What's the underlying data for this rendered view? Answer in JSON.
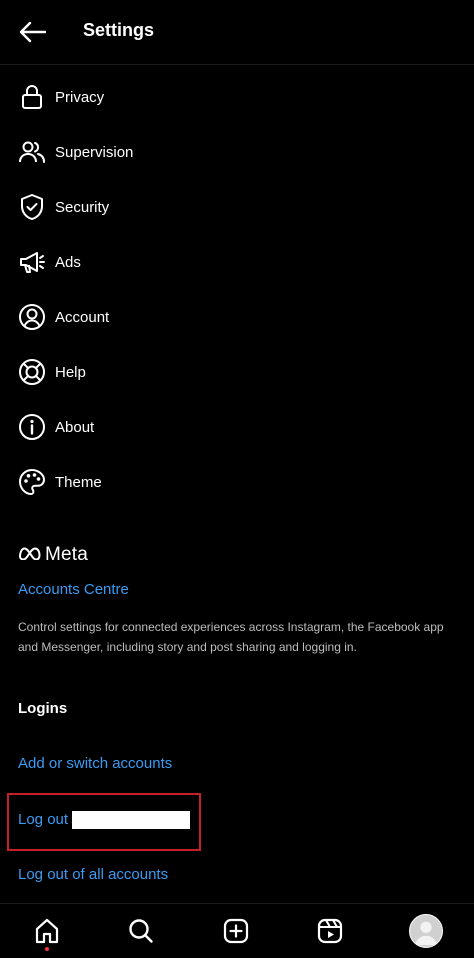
{
  "header": {
    "title": "Settings",
    "back_icon": "arrow-left-icon"
  },
  "menu": [
    {
      "label": "Privacy",
      "icon": "lock-icon"
    },
    {
      "label": "Supervision",
      "icon": "people-icon"
    },
    {
      "label": "Security",
      "icon": "shield-check-icon"
    },
    {
      "label": "Ads",
      "icon": "megaphone-icon"
    },
    {
      "label": "Account",
      "icon": "user-circle-icon"
    },
    {
      "label": "Help",
      "icon": "lifebuoy-icon"
    },
    {
      "label": "About",
      "icon": "info-icon"
    },
    {
      "label": "Theme",
      "icon": "palette-icon"
    }
  ],
  "meta": {
    "brand": "Meta",
    "accounts_centre": "Accounts Centre",
    "description": "Control settings for connected experiences across Instagram, the Facebook app and Messenger, including story and post sharing and logging in."
  },
  "logins": {
    "heading": "Logins",
    "add_switch": "Add or switch accounts",
    "log_out": "Log out",
    "log_out_all": "Log out of all accounts"
  },
  "colors": {
    "link": "#3b9bf2",
    "highlight_border": "#c4202a",
    "notification_dot": "#ff3040"
  },
  "bottom_nav": [
    "home-icon",
    "search-icon",
    "create-icon",
    "reels-icon",
    "profile-avatar"
  ]
}
